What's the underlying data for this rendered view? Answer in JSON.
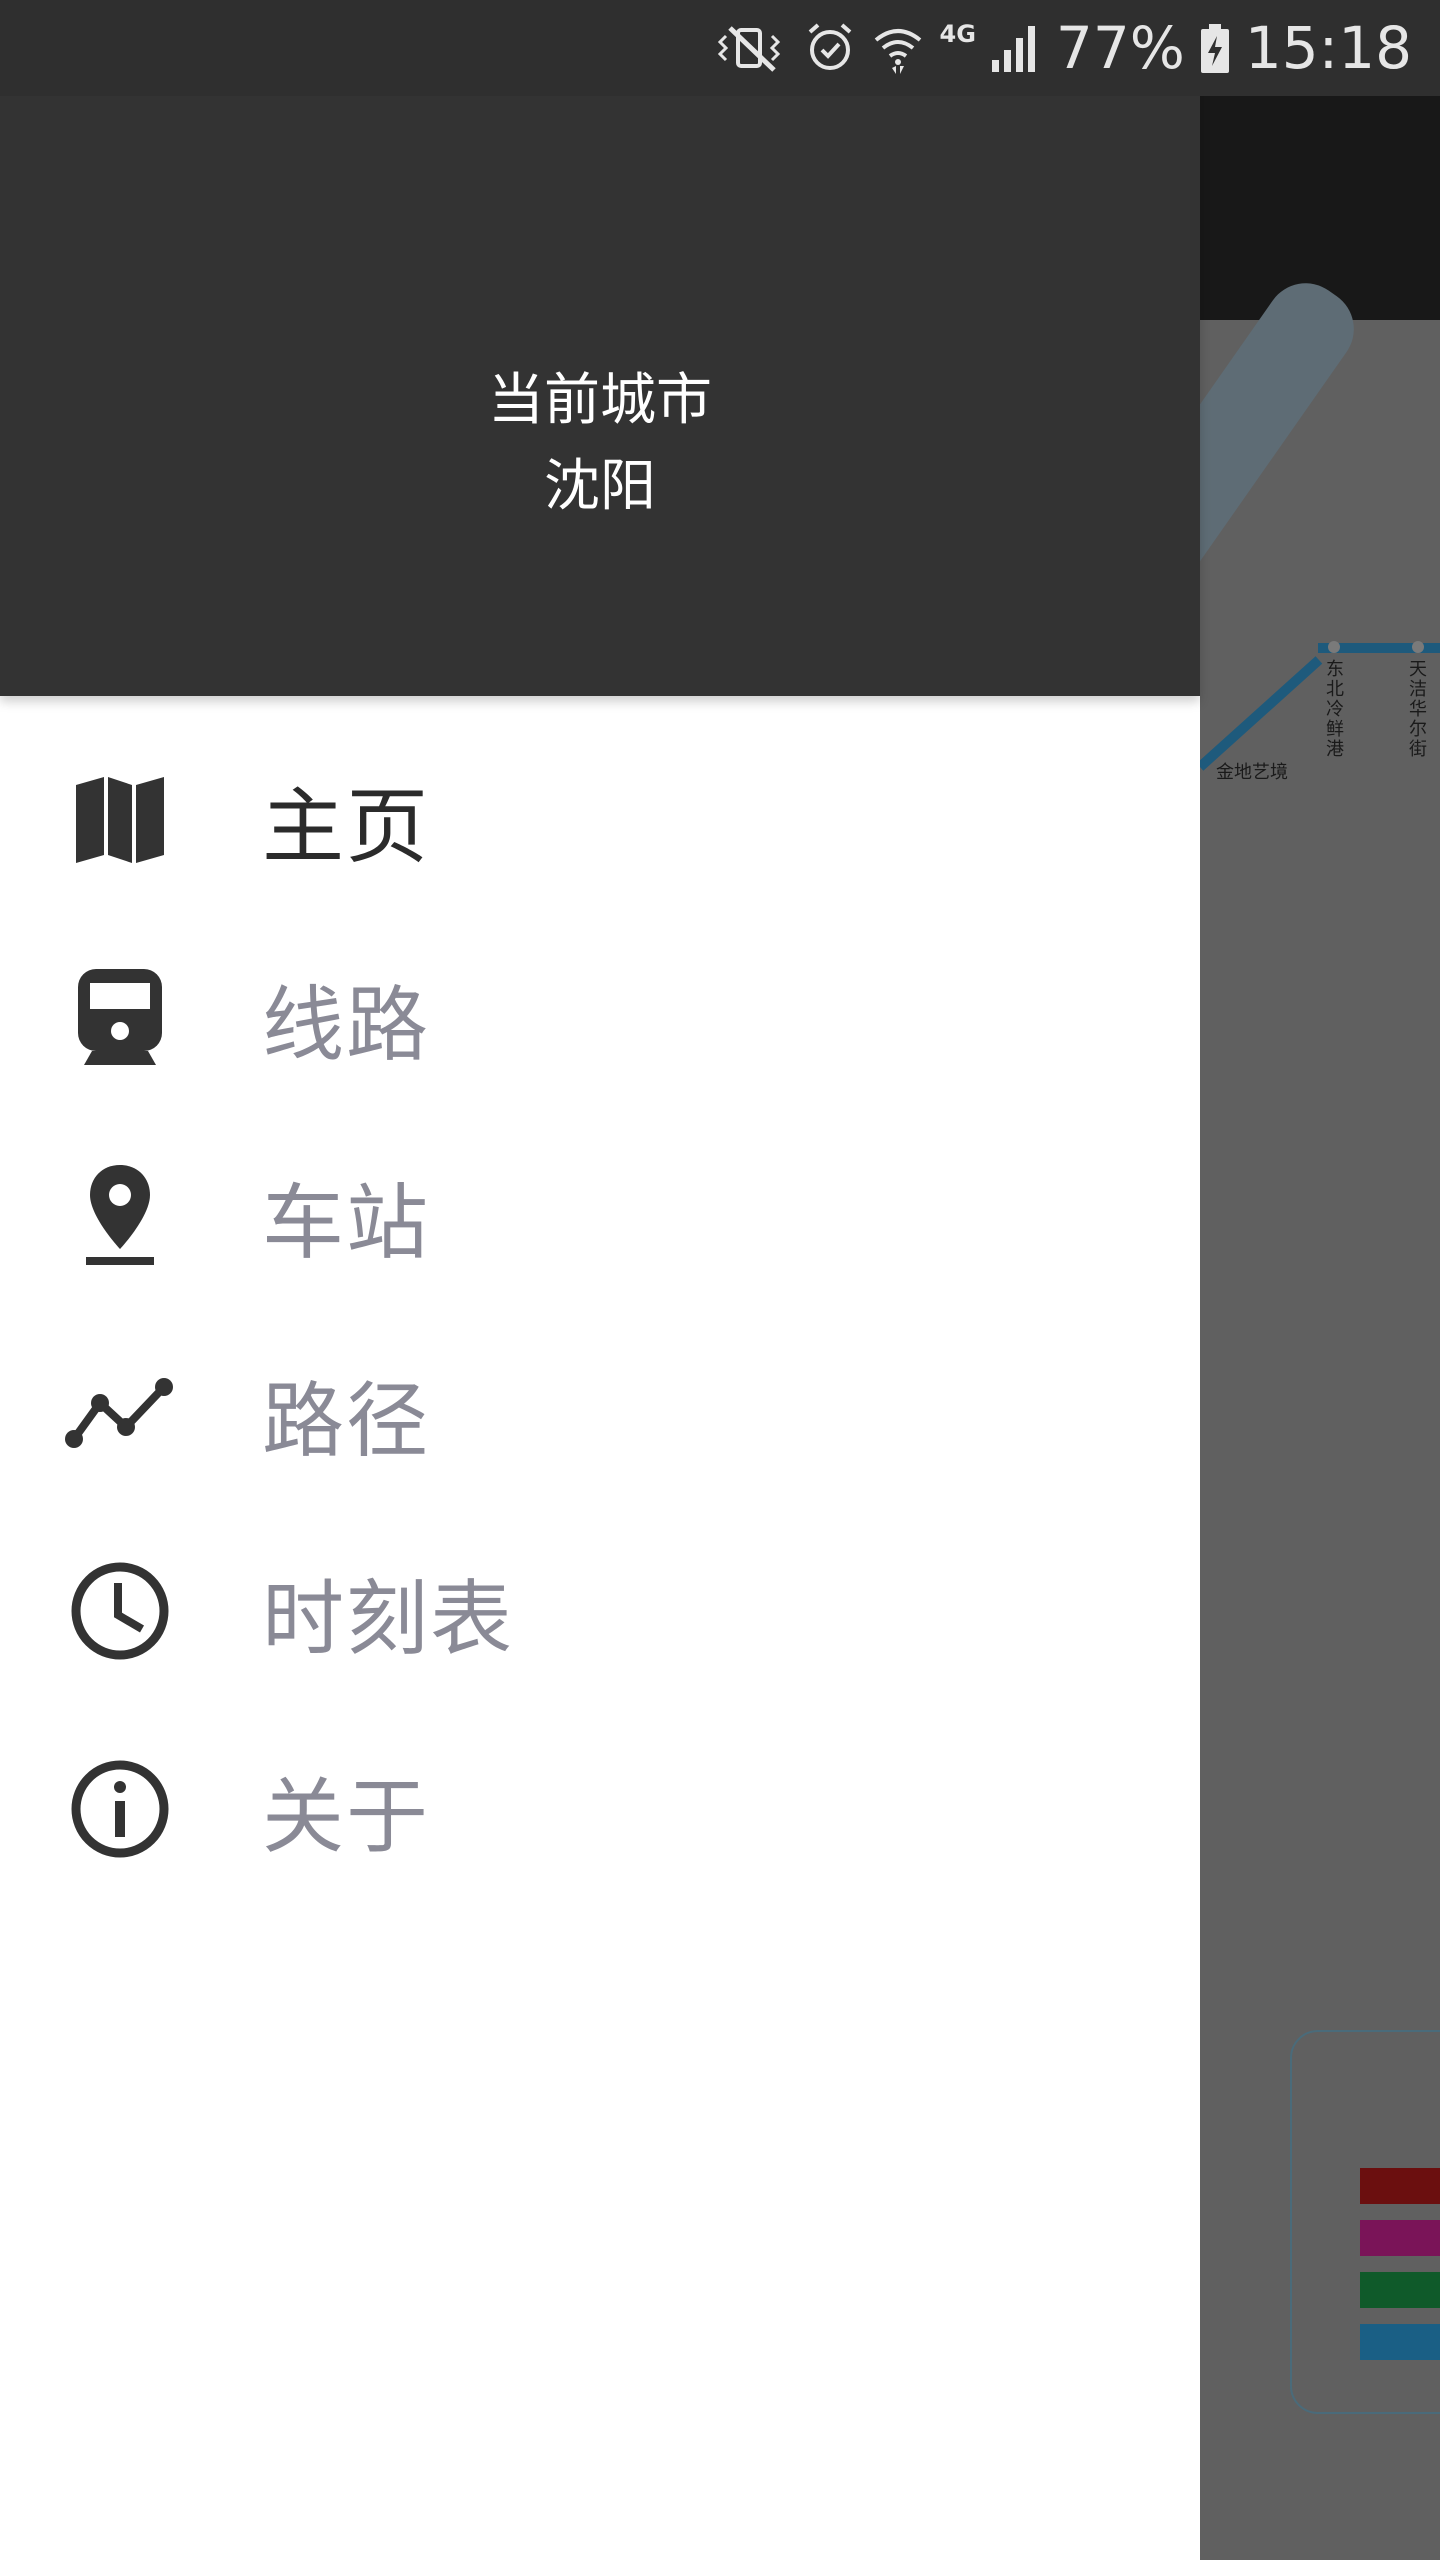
{
  "status_bar": {
    "battery_percent": "77%",
    "time": "15:18",
    "network_type": "4G",
    "icons": [
      "vibrate-mute-icon",
      "alarm-icon",
      "wifi-icon",
      "cellular-signal-icon",
      "battery-charging-icon"
    ]
  },
  "drawer": {
    "header": {
      "title": "当前城市",
      "city": "沈阳"
    },
    "menu": [
      {
        "label": "主页",
        "icon": "map-icon",
        "active": true
      },
      {
        "label": "线路",
        "icon": "train-icon",
        "active": false
      },
      {
        "label": "车站",
        "icon": "place-pin-icon",
        "active": false
      },
      {
        "label": "路径",
        "icon": "route-icon",
        "active": false
      },
      {
        "label": "时刻表",
        "icon": "clock-icon",
        "active": false
      },
      {
        "label": "关于",
        "icon": "info-icon",
        "active": false
      }
    ]
  },
  "background_map": {
    "stations": [
      "东北冷鲜港",
      "天洁华尔街",
      "金地艺境"
    ],
    "colors": {
      "line_blue": "#1e5a7c",
      "legend": [
        "#6b0f0f",
        "#7a1458",
        "#0f5a2a",
        "#1a5f85"
      ]
    }
  },
  "colors": {
    "header_bg": "#333333",
    "status_bar_bg": "#2f2f2f",
    "drawer_bg": "#ffffff",
    "active_text": "#2b2b2b",
    "inactive_text": "#8a8a96",
    "icon_color": "#333333"
  }
}
